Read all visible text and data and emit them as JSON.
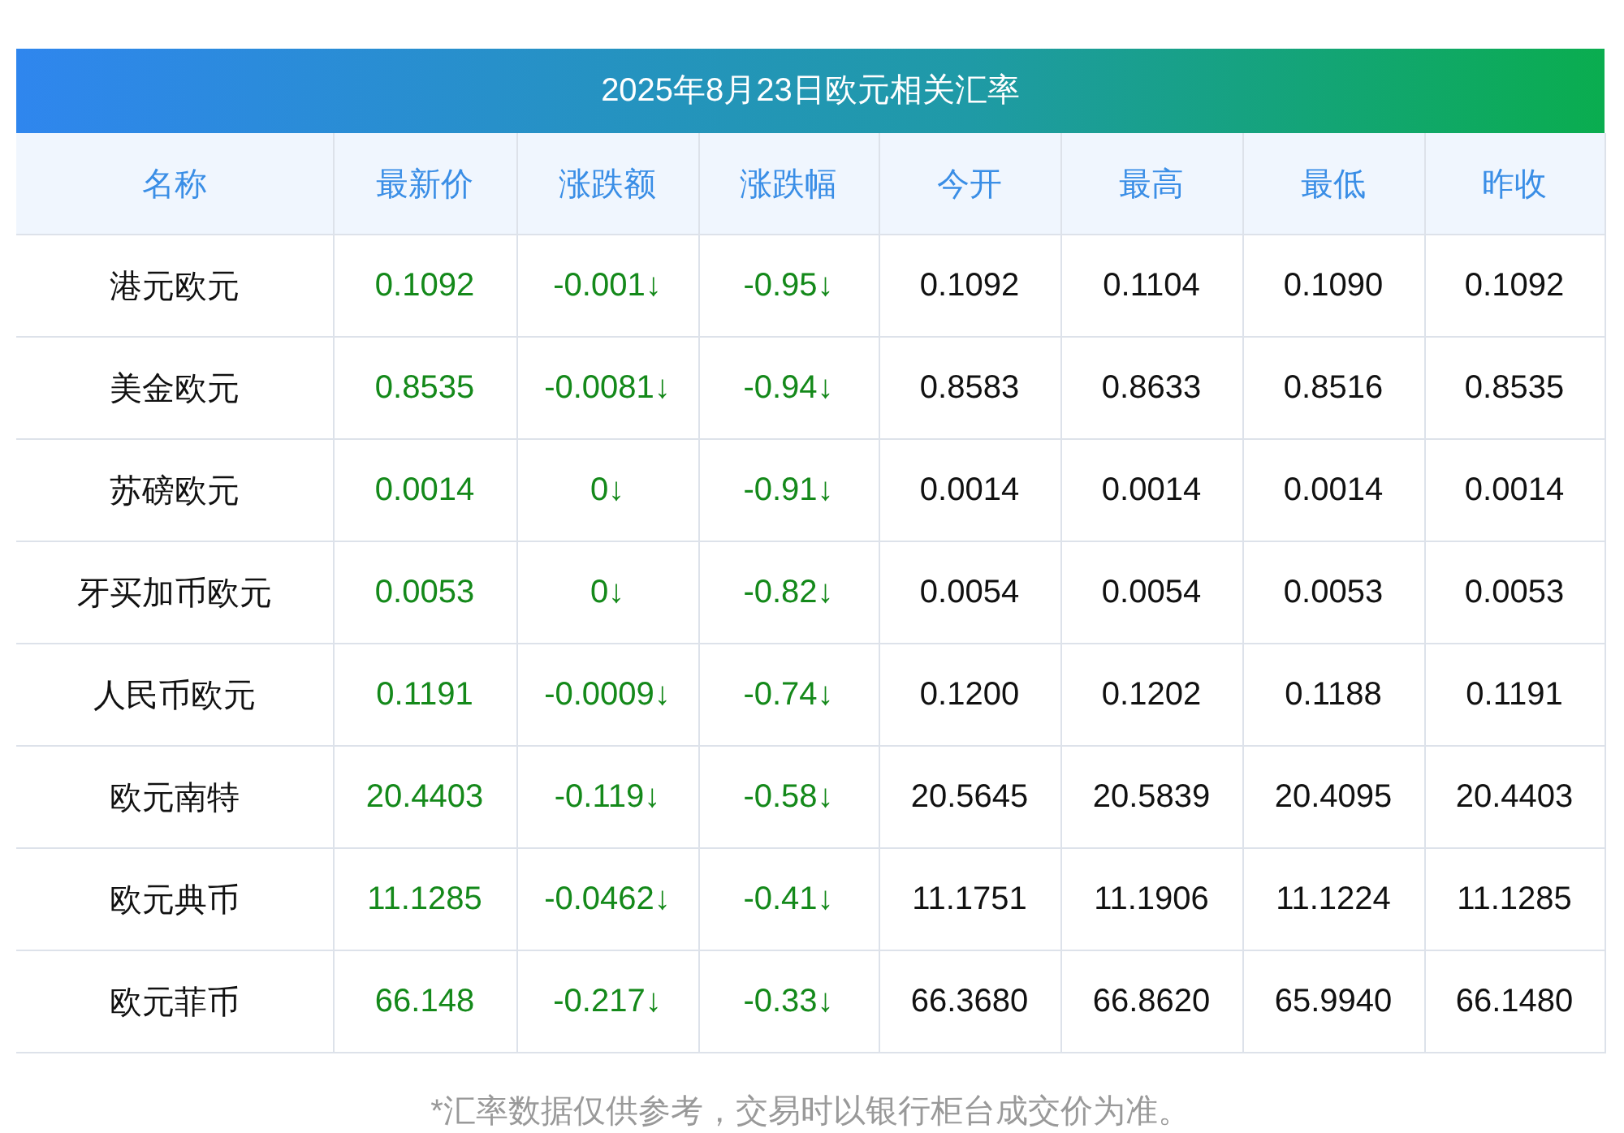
{
  "table": {
    "title": "2025年8月23日欧元相关汇率",
    "columns": [
      "名称",
      "最新价",
      "涨跌额",
      "涨跌幅",
      "今开",
      "最高",
      "最低",
      "昨收"
    ],
    "rows": [
      {
        "down": true,
        "cells": [
          "港元欧元",
          "0.1092",
          "-0.001↓",
          "-0.95↓",
          "0.1092",
          "0.1104",
          "0.1090",
          "0.1092"
        ]
      },
      {
        "down": true,
        "cells": [
          "美金欧元",
          "0.8535",
          "-0.0081↓",
          "-0.94↓",
          "0.8583",
          "0.8633",
          "0.8516",
          "0.8535"
        ]
      },
      {
        "down": true,
        "cells": [
          "苏磅欧元",
          "0.0014",
          "0↓",
          "-0.91↓",
          "0.0014",
          "0.0014",
          "0.0014",
          "0.0014"
        ]
      },
      {
        "down": true,
        "cells": [
          "牙买加币欧元",
          "0.0053",
          "0↓",
          "-0.82↓",
          "0.0054",
          "0.0054",
          "0.0053",
          "0.0053"
        ]
      },
      {
        "down": true,
        "cells": [
          "人民币欧元",
          "0.1191",
          "-0.0009↓",
          "-0.74↓",
          "0.1200",
          "0.1202",
          "0.1188",
          "0.1191"
        ]
      },
      {
        "down": true,
        "cells": [
          "欧元南特",
          "20.4403",
          "-0.119↓",
          "-0.58↓",
          "20.5645",
          "20.5839",
          "20.4095",
          "20.4403"
        ]
      },
      {
        "down": true,
        "cells": [
          "欧元典币",
          "11.1285",
          "-0.0462↓",
          "-0.41↓",
          "11.1751",
          "11.1906",
          "11.1224",
          "11.1285"
        ]
      },
      {
        "down": true,
        "cells": [
          "欧元菲币",
          "66.148",
          "-0.217↓",
          "-0.33↓",
          "66.3680",
          "66.8620",
          "65.9940",
          "66.1480"
        ]
      }
    ]
  },
  "footnote": "*汇率数据仅供参考，交易时以银行柜台成交价为准。"
}
